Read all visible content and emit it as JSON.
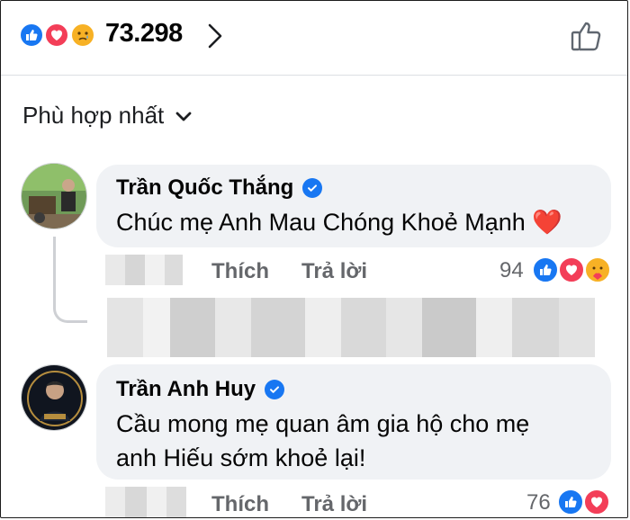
{
  "reactions_summary": {
    "icons": [
      "like-icon",
      "love-icon",
      "sad-icon"
    ],
    "total": "73.298"
  },
  "sort": {
    "label": "Phù hợp nhất"
  },
  "comments": [
    {
      "author": "Trần Quốc Thắng",
      "verified": true,
      "text": "Chúc mẹ Anh Mau Chóng Khoẻ Mạnh",
      "emoji": "❤️",
      "actions": {
        "like": "Thích",
        "reply": "Trả lời"
      },
      "reaction_count": "94",
      "reaction_icons": [
        "like-icon",
        "love-icon",
        "care-icon"
      ]
    },
    {
      "author": "Trần Anh Huy",
      "verified": true,
      "text_line1": "Cầu mong mẹ quan âm gia hộ cho mẹ",
      "text_line2": "anh Hiếu sớm khoẻ lại!",
      "actions": {
        "like": "Thích",
        "reply": "Trả lời"
      },
      "reaction_count": "76",
      "reaction_icons": [
        "like-icon",
        "love-icon"
      ]
    }
  ],
  "colors": {
    "like": "#1877f2",
    "love": "#f33e58",
    "sad": "#f7b125",
    "bubble": "#f0f2f5",
    "secondary_text": "#65676b"
  }
}
